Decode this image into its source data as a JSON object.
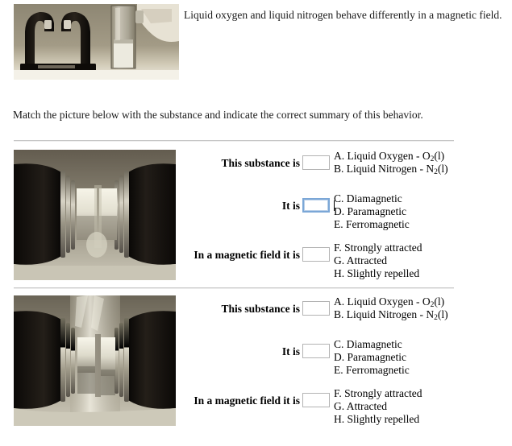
{
  "page": {
    "intro_text": "Liquid oxygen and liquid nitrogen behave differently in a magnetic field.",
    "prompt_text": "Match the picture below with the substance and indicate the correct summary of this behavior.",
    "background_color": "#ffffff",
    "text_color": "#1a1a1a",
    "divider_color": "#c6c6c6",
    "focus_border_color": "#7ba7d7",
    "input_border_color": "#b3b3b3"
  },
  "header_image": {
    "alt": "Black U-shaped electromagnet on a base beside a clear glass dewar of cryogenic liquid held by a gloved hand",
    "name": "electromagnet-and-dewar-photo"
  },
  "questions": [
    {
      "id": "question-1",
      "image": {
        "alt": "Close-up of electromagnet pole pieces with pale liquid suspended and held between the poles",
        "name": "liquid-held-between-poles-photo",
        "state": "liquid-suspended-between-poles"
      },
      "rows": [
        {
          "label": "This substance is",
          "field_name": "substance-input",
          "value": "",
          "focused": false,
          "options": [
            {
              "letter": "A.",
              "text": "Liquid Oxygen - O",
              "sub": "2",
              "tail": "(l)"
            },
            {
              "letter": "B.",
              "text": "Liquid Nitrogen - N",
              "sub": "2",
              "tail": "(l)"
            }
          ]
        },
        {
          "label": "It is",
          "field_name": "magnetism-type-input",
          "value": "",
          "focused": true,
          "options": [
            {
              "letter": "C.",
              "text": "Diamagnetic",
              "sub": "",
              "tail": ""
            },
            {
              "letter": "D.",
              "text": "Paramagnetic",
              "sub": "",
              "tail": ""
            },
            {
              "letter": "E.",
              "text": "Ferromagnetic",
              "sub": "",
              "tail": ""
            }
          ]
        },
        {
          "label": "In a magnetic field it is",
          "field_name": "field-behavior-input",
          "value": "",
          "focused": false,
          "options": [
            {
              "letter": "F.",
              "text": "Strongly attracted",
              "sub": "",
              "tail": ""
            },
            {
              "letter": "G.",
              "text": "Attracted",
              "sub": "",
              "tail": ""
            },
            {
              "letter": "H.",
              "text": "Slightly repelled",
              "sub": "",
              "tail": ""
            }
          ]
        }
      ]
    },
    {
      "id": "question-2",
      "image": {
        "alt": "Close-up of electromagnet pole pieces with pale liquid streaming straight down past the poles",
        "name": "liquid-falling-past-poles-photo",
        "state": "liquid-pouring-past-poles"
      },
      "rows": [
        {
          "label": "This substance is",
          "field_name": "substance-input",
          "value": "",
          "focused": false,
          "options": [
            {
              "letter": "A.",
              "text": "Liquid Oxygen - O",
              "sub": "2",
              "tail": "(l)"
            },
            {
              "letter": "B.",
              "text": "Liquid Nitrogen - N",
              "sub": "2",
              "tail": "(l)"
            }
          ]
        },
        {
          "label": "It is",
          "field_name": "magnetism-type-input",
          "value": "",
          "focused": false,
          "options": [
            {
              "letter": "C.",
              "text": "Diamagnetic",
              "sub": "",
              "tail": ""
            },
            {
              "letter": "D.",
              "text": "Paramagnetic",
              "sub": "",
              "tail": ""
            },
            {
              "letter": "E.",
              "text": "Ferromagnetic",
              "sub": "",
              "tail": ""
            }
          ]
        },
        {
          "label": "In a magnetic field it is",
          "field_name": "field-behavior-input",
          "value": "",
          "focused": false,
          "options": [
            {
              "letter": "F.",
              "text": "Strongly attracted",
              "sub": "",
              "tail": ""
            },
            {
              "letter": "G.",
              "text": "Attracted",
              "sub": "",
              "tail": ""
            },
            {
              "letter": "H.",
              "text": "Slightly repelled",
              "sub": "",
              "tail": ""
            }
          ]
        }
      ]
    }
  ]
}
